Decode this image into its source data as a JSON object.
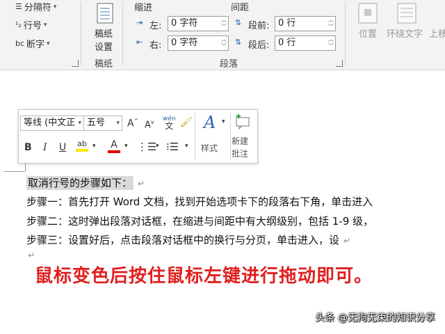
{
  "ribbon": {
    "items": {
      "page_columns": "分隔符",
      "line_numbers": "行号",
      "hyphenation": "断字",
      "manuscript_line1": "稿纸",
      "manuscript_line2": "设置",
      "manuscript_group": "稿纸",
      "indent_header": "缩进",
      "spacing_header": "间距",
      "indent_left_label": "左:",
      "indent_left_value": "0 字符",
      "indent_right_label": "右:",
      "indent_right_value": "0 字符",
      "space_before_label": "段前:",
      "space_before_value": "0 行",
      "space_after_label": "段后:",
      "space_after_value": "0 行",
      "paragraph_group": "段落",
      "position": "位置",
      "wrap_text": "环绕文字",
      "bring_forward": "上移"
    }
  },
  "mini_toolbar": {
    "font_name": "等线 (中文正",
    "font_size": "五号",
    "styles": "样式",
    "new_comment_line1": "新建",
    "new_comment_line2": "批注"
  },
  "document": {
    "lines": [
      "取消行号的步骤如下：",
      "步骤一：首先打开 Word 文档，找到开始选项卡下的段落右下角，单击进入",
      "步骤二：这时弹出段落对话框，在缩进与间距中有大纲级别，包括 1-9 级，",
      "步骤三：设置好后，点击段落对话框中的换行与分页，单击进入，设"
    ],
    "caption": "鼠标变色后按住鼠标左键进行拖动即可。"
  },
  "watermark": "头条 @无拘无束的知识分享",
  "colors": {
    "caption": "#e02020",
    "highlight": "#ffe600",
    "font_color": "#e00000",
    "selection": "#d9d9d9"
  }
}
